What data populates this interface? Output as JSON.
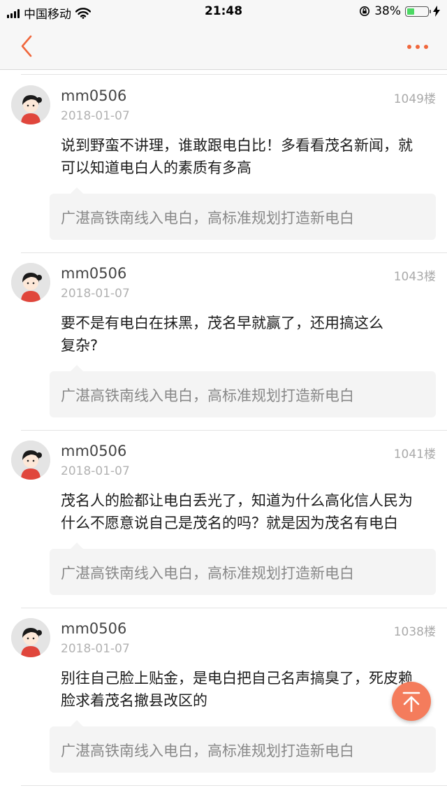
{
  "status_bar": {
    "carrier": "中国移动",
    "time": "21:48",
    "battery_percent": "38%",
    "battery_level": 0.38,
    "icons": [
      "signal-icon",
      "wifi-icon",
      "rotation-lock-icon",
      "battery-icon",
      "charging-icon"
    ]
  },
  "navbar": {
    "back_icon": "chevron-left-icon",
    "more_icon": "more-dots-icon",
    "accent_color": "#f0673c"
  },
  "posts": [
    {
      "author": "mm0506",
      "date": "2018-01-07",
      "floor": "1049楼",
      "lines": [
        "说到野蛮不讲理，谁敢跟电白比！多看看茂名新闻，就",
        "可以知道电白人的素质有多高"
      ],
      "quote": "广湛高铁南线入电白，高标准规划打造新电白"
    },
    {
      "author": "mm0506",
      "date": "2018-01-07",
      "floor": "1043楼",
      "lines": [
        "要不是有电白在抹黑，茂名早就赢了，还用搞这么",
        "复杂?"
      ],
      "quote": "广湛高铁南线入电白，高标准规划打造新电白"
    },
    {
      "author": "mm0506",
      "date": "2018-01-07",
      "floor": "1041楼",
      "lines": [
        "茂名人的脸都让电白丢光了，知道为什么高化信人民为",
        "什么不愿意说自己是茂名的吗？就是因为茂名有电白"
      ],
      "quote": "广湛高铁南线入电白，高标准规划打造新电白"
    },
    {
      "author": "mm0506",
      "date": "2018-01-07",
      "floor": "1038楼",
      "lines": [
        "别往自己脸上贴金，是电白把自己名声搞臭了，死皮赖",
        "脸求着茂名撤县改区的"
      ],
      "quote": "广湛高铁南线入电白，高标准规划打造新电白"
    }
  ],
  "to_top_button": {
    "icon": "arrow-to-top-icon",
    "color": "#f47c5c"
  }
}
